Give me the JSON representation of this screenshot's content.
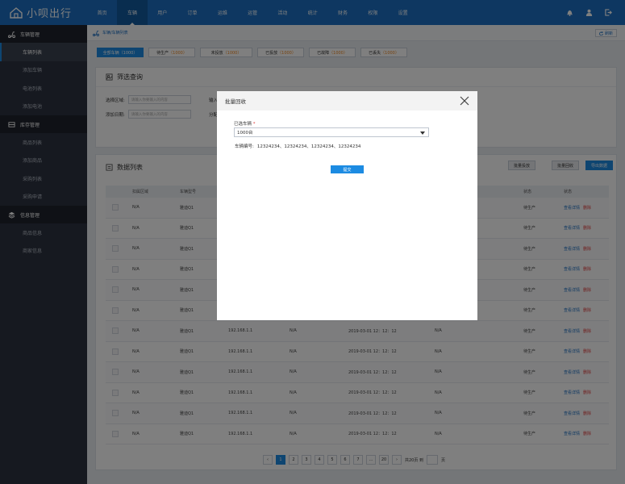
{
  "brand": {
    "name": "小呗出行"
  },
  "nav": [
    {
      "label": "首页"
    },
    {
      "label": "车辆",
      "active": true
    },
    {
      "label": "用户"
    },
    {
      "label": "订单"
    },
    {
      "label": "运维"
    },
    {
      "label": "运管"
    },
    {
      "label": "活动"
    },
    {
      "label": "统计"
    },
    {
      "label": "财务"
    },
    {
      "label": "权限"
    },
    {
      "label": "设置"
    }
  ],
  "sidebar": {
    "vehicle": {
      "title": "车辆管理",
      "items": [
        "车辆列表",
        "添加车辆",
        "电池列表",
        "添加电池"
      ]
    },
    "inventory": {
      "title": "库存管理",
      "items": [
        "商品列表",
        "添加商品",
        "采购列表",
        "采购申请"
      ]
    },
    "info": {
      "title": "信息管理",
      "items": [
        "商品信息",
        "商家信息"
      ]
    }
  },
  "breadcrumb": "车辆/车辆列表",
  "refresh_label": "刷新",
  "tabs": [
    {
      "label": "全部车辆",
      "count": "（1000）",
      "active": true
    },
    {
      "label": "待生产",
      "count": "（1000）"
    },
    {
      "label": "未投放",
      "count": "（1000）"
    },
    {
      "label": "已投放",
      "count": "（1000）"
    },
    {
      "label": "已故障",
      "count": "（1000）"
    },
    {
      "label": "已丢失",
      "count": "（1000）"
    }
  ],
  "filter": {
    "title": "筛选查询",
    "area_label": "选择区域:",
    "area_placeholder": "请输入你要输入的内容",
    "date_label": "添加日期:",
    "date_placeholder": "请输入你要输入的内容",
    "input_label_partial": "输入",
    "alloc_label_partial": "分配"
  },
  "datalist": {
    "title": "数据列表",
    "actions": {
      "batch_deploy": "批量投放",
      "batch_recall": "批量回收",
      "export": "导出数据"
    },
    "headers": {
      "area": "扣属区域",
      "model": "车辆型号",
      "status1": "状态",
      "status2": "状态"
    },
    "rows": [
      {
        "area": "N/A",
        "model": "雅迪Q1",
        "ip": "",
        "c4": "",
        "date": "",
        "c6": "",
        "status": "待生产"
      },
      {
        "area": "N/A",
        "model": "雅迪Q1",
        "ip": "",
        "c4": "",
        "date": "",
        "c6": "",
        "status": "待生产"
      },
      {
        "area": "N/A",
        "model": "雅迪Q1",
        "ip": "",
        "c4": "",
        "date": "",
        "c6": "",
        "status": "待生产"
      },
      {
        "area": "N/A",
        "model": "雅迪Q1",
        "ip": "",
        "c4": "",
        "date": "",
        "c6": "",
        "status": "待生产"
      },
      {
        "area": "N/A",
        "model": "雅迪Q1",
        "ip": "",
        "c4": "",
        "date": "",
        "c6": "",
        "status": "待生产"
      },
      {
        "area": "N/A",
        "model": "雅迪Q1",
        "ip": "",
        "c4": "",
        "date": "",
        "c6": "",
        "status": "待生产"
      },
      {
        "area": "N/A",
        "model": "雅迪Q1",
        "ip": "192.168.1.1",
        "c4": "N/A",
        "date": "2019-03-01 12：12：12",
        "c6": "N/A",
        "status": "待生产"
      },
      {
        "area": "N/A",
        "model": "雅迪Q1",
        "ip": "192.168.1.1",
        "c4": "N/A",
        "date": "2019-03-01 12：12：12",
        "c6": "N/A",
        "status": "待生产"
      },
      {
        "area": "N/A",
        "model": "雅迪Q1",
        "ip": "192.168.1.1",
        "c4": "N/A",
        "date": "2019-03-01 12：12：12",
        "c6": "N/A",
        "status": "待生产"
      },
      {
        "area": "N/A",
        "model": "雅迪Q1",
        "ip": "192.168.1.1",
        "c4": "N/A",
        "date": "2019-03-01 12：12：12",
        "c6": "N/A",
        "status": "待生产"
      },
      {
        "area": "N/A",
        "model": "雅迪Q1",
        "ip": "192.168.1.1",
        "c4": "N/A",
        "date": "2019-03-01 12：12：12",
        "c6": "N/A",
        "status": "待生产"
      },
      {
        "area": "N/A",
        "model": "雅迪Q1",
        "ip": "192.168.1.1",
        "c4": "N/A",
        "date": "2019-03-01 12：12：12",
        "c6": "N/A",
        "status": "待生产"
      }
    ],
    "row_actions": {
      "detail": "查看详情",
      "delete": "删除"
    }
  },
  "pagination": {
    "pages": [
      "1",
      "2",
      "3",
      "4",
      "5",
      "6",
      "7",
      "...",
      "20"
    ],
    "prev": "‹",
    "next": "›",
    "total": "共20页 到",
    "page_unit": "页"
  },
  "modal": {
    "title": "批量回收",
    "selected_label": "已选车辆",
    "required_mark": "*",
    "selected_value": "1000台",
    "ids_label": "车辆编号:",
    "ids_value": "12324234、12324234、12324234、12324234",
    "submit": "提交"
  }
}
